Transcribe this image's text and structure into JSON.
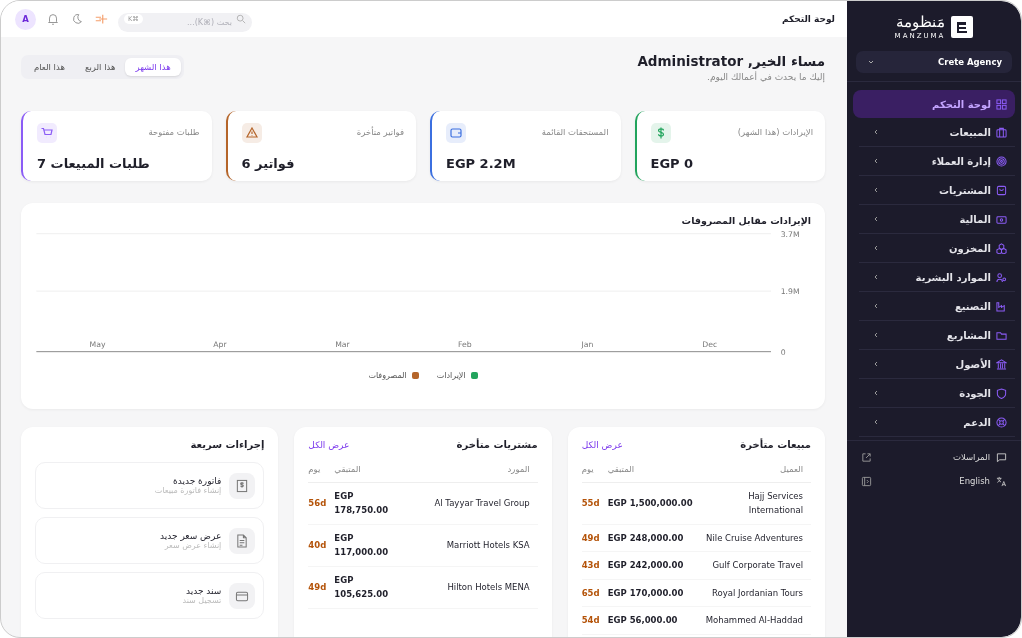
{
  "sidebar": {
    "brand_arabic": "مَنظومة",
    "brand_latin": "MANZUMA",
    "agency": "Crete Agency",
    "items": [
      {
        "label": "لوحة التحكم",
        "selected": true,
        "has_submenu": false
      },
      {
        "label": "المبيعات",
        "selected": false,
        "has_submenu": true
      },
      {
        "label": "إدارة العملاء",
        "selected": false,
        "has_submenu": true
      },
      {
        "label": "المشتريات",
        "selected": false,
        "has_submenu": true
      },
      {
        "label": "المالية",
        "selected": false,
        "has_submenu": true
      },
      {
        "label": "المخزون",
        "selected": false,
        "has_submenu": true
      },
      {
        "label": "الموارد البشرية",
        "selected": false,
        "has_submenu": true
      },
      {
        "label": "التصنيع",
        "selected": false,
        "has_submenu": true
      },
      {
        "label": "المشاريع",
        "selected": false,
        "has_submenu": true
      },
      {
        "label": "الأصول",
        "selected": false,
        "has_submenu": true
      },
      {
        "label": "الجودة",
        "selected": false,
        "has_submenu": true
      },
      {
        "label": "الدعم",
        "selected": false,
        "has_submenu": true
      }
    ],
    "footer_links": [
      {
        "label": "المراسلات"
      },
      {
        "label": "English"
      }
    ]
  },
  "topbar": {
    "breadcrumb": "لوحة التحكم",
    "search_placeholder": "بحث (⌘K)...",
    "search_shortcut": "K⌘",
    "avatar": "A"
  },
  "greeting": {
    "title": "مساء الخير, Administrator",
    "subtitle": "إليك ما يحدث في أعمالك اليوم."
  },
  "period_tabs": [
    {
      "label": "هذا الشهر",
      "selected": true
    },
    {
      "label": "هذا الربع",
      "selected": false
    },
    {
      "label": "هذا العام",
      "selected": false
    }
  ],
  "kpis": [
    {
      "label": "الإيرادات (هذا الشهر)",
      "value": "EGP 0",
      "color": "#22a45d"
    },
    {
      "label": "المستحقات القائمة",
      "value": "EGP 2.2M",
      "color": "#3b6fe0"
    },
    {
      "label": "فواتير متأخرة",
      "value": "فواتير 6",
      "color": "#b5652a"
    },
    {
      "label": "طلبات مفتوحة",
      "value": "طلبات المبيعات 7",
      "color": "#8b5cf6"
    }
  ],
  "chart": {
    "title": "الإيرادات مقابل المصروفات",
    "chart_data": {
      "type": "line",
      "categories": [
        "May",
        "Apr",
        "Mar",
        "Feb",
        "Jan",
        "Dec"
      ],
      "legend": "bottom",
      "ylim": [
        0,
        3700000
      ],
      "yticks": [
        {
          "value": 0,
          "label": "0"
        },
        {
          "value": 1900000,
          "label": "1.9M"
        },
        {
          "value": 3700000,
          "label": "3.7M"
        }
      ],
      "series": [
        {
          "name": "الإيرادات",
          "color": "#22a45d",
          "values": [
            null,
            null,
            null,
            null,
            null,
            null
          ]
        },
        {
          "name": "المصروفات",
          "color": "#b5652a",
          "values": [
            null,
            null,
            null,
            null,
            null,
            null
          ]
        }
      ]
    }
  },
  "late_sales": {
    "title": "مبيعات متأخرة",
    "link": "عرض الكل",
    "columns": [
      "العميل",
      "المتبقي",
      "يوم"
    ],
    "rows": [
      {
        "name": "Hajj Services International",
        "amount": "EGP 1,500,000.00",
        "days": "55d"
      },
      {
        "name": "Nile Cruise Adventures",
        "amount": "EGP 248,000.00",
        "days": "49d"
      },
      {
        "name": "Gulf Corporate Travel",
        "amount": "EGP 242,000.00",
        "days": "43d"
      },
      {
        "name": "Royal Jordanian Tours",
        "amount": "EGP 170,000.00",
        "days": "65d"
      },
      {
        "name": "Mohammed Al-Haddad",
        "amount": "EGP 56,000.00",
        "days": "54d"
      }
    ]
  },
  "late_purchases": {
    "title": "مشتريات متأخرة",
    "link": "عرض الكل",
    "columns": [
      "المورد",
      "المتبقي",
      "يوم"
    ],
    "rows": [
      {
        "name": "Al Tayyar Travel Group",
        "amount": "EGP 178,750.00",
        "days": "56d"
      },
      {
        "name": "Marriott Hotels KSA",
        "amount": "EGP 117,000.00",
        "days": "40d"
      },
      {
        "name": "Hilton Hotels MENA",
        "amount": "EGP 105,625.00",
        "days": "49d"
      }
    ]
  },
  "quick_actions": {
    "title": "إجراءات سريعة",
    "items": [
      {
        "title": "فاتورة جديدة",
        "subtitle": "إنشاء فاتورة مبيعات"
      },
      {
        "title": "عرض سعر جديد",
        "subtitle": "إنشاء عرض سعر"
      },
      {
        "title": "سند جديد",
        "subtitle": "تسجيل سند"
      }
    ]
  }
}
